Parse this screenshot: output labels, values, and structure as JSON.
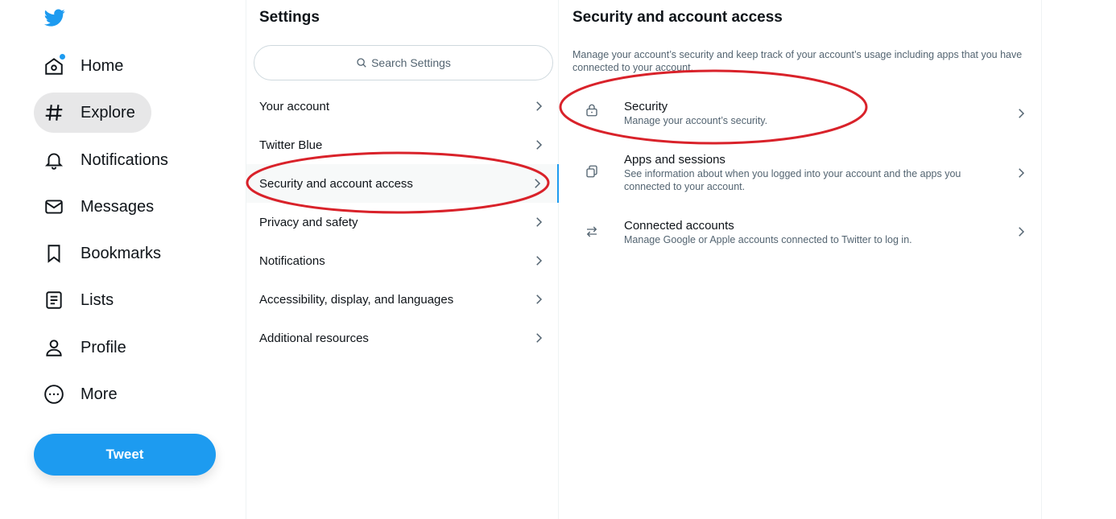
{
  "nav": {
    "items": [
      {
        "label": "Home",
        "icon": "home-icon"
      },
      {
        "label": "Explore",
        "icon": "hashtag-icon"
      },
      {
        "label": "Notifications",
        "icon": "bell-icon"
      },
      {
        "label": "Messages",
        "icon": "envelope-icon"
      },
      {
        "label": "Bookmarks",
        "icon": "bookmark-icon"
      },
      {
        "label": "Lists",
        "icon": "list-icon"
      },
      {
        "label": "Profile",
        "icon": "person-icon"
      },
      {
        "label": "More",
        "icon": "more-circle-icon"
      }
    ],
    "active": "Explore",
    "tweet_label": "Tweet"
  },
  "settings": {
    "title": "Settings",
    "search_placeholder": "Search Settings",
    "items": [
      {
        "label": "Your account"
      },
      {
        "label": "Twitter Blue"
      },
      {
        "label": "Security and account access"
      },
      {
        "label": "Privacy and safety"
      },
      {
        "label": "Notifications"
      },
      {
        "label": "Accessibility, display, and languages"
      },
      {
        "label": "Additional resources"
      }
    ],
    "selected": "Security and account access"
  },
  "detail": {
    "title": "Security and account access",
    "description": "Manage your account’s security and keep track of your account’s usage including apps that you have connected to your account.",
    "items": [
      {
        "label": "Security",
        "sub": "Manage your account’s security.",
        "icon": "lock-icon"
      },
      {
        "label": "Apps and sessions",
        "sub": "See information about when you logged into your account and the apps you connected to your account.",
        "icon": "copy-icon"
      },
      {
        "label": "Connected accounts",
        "sub": "Manage Google or Apple accounts connected to Twitter to log in.",
        "icon": "swap-arrows-icon"
      }
    ]
  },
  "colors": {
    "accent": "#1d9bf0",
    "annotation": "#d9222a",
    "text_primary": "#0f1419",
    "text_secondary": "#536471"
  }
}
